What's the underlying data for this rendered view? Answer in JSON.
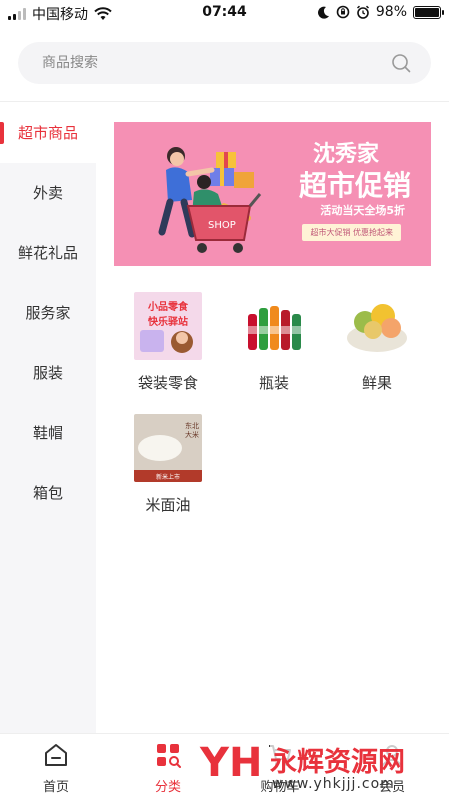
{
  "status_bar": {
    "carrier": "中国移动",
    "time": "07:44",
    "battery": "98%",
    "battery_level": 0.98
  },
  "search": {
    "placeholder": "商品搜索",
    "icon": "search-icon"
  },
  "sidebar": {
    "items": [
      {
        "label": "超市商品",
        "active": true
      },
      {
        "label": "外卖",
        "active": false
      },
      {
        "label": "鲜花礼品",
        "active": false
      },
      {
        "label": "服务家",
        "active": false
      },
      {
        "label": "服装",
        "active": false
      },
      {
        "label": "鞋帽",
        "active": false
      },
      {
        "label": "箱包",
        "active": false
      }
    ]
  },
  "banner": {
    "line1": "沈秀家",
    "line2": "超市促销",
    "line3": "活动当天全场5折",
    "pill": "超市大促销 优惠抢起来",
    "cart_text": "SHOP",
    "color": "#f590b4"
  },
  "categories": [
    {
      "label": "袋装零食",
      "thumb_text1": "小品零食",
      "thumb_text2": "快乐驿站"
    },
    {
      "label": "瓶装"
    },
    {
      "label": "鲜果"
    },
    {
      "label": "米面油",
      "thumb_text1": "东北大米",
      "thumb_text2": "新米上市"
    }
  ],
  "tabbar": {
    "items": [
      {
        "label": "首页",
        "icon": "home-icon",
        "active": false
      },
      {
        "label": "分类",
        "icon": "category-icon",
        "active": true
      },
      {
        "label": "购物车",
        "icon": "cart-icon",
        "active": false
      },
      {
        "label": "会员",
        "icon": "member-icon",
        "active": false
      }
    ]
  },
  "watermark": {
    "logo": "YH",
    "title": "永辉资源网",
    "url": "www.yhkjjj.com"
  },
  "colors": {
    "accent": "#e8323c",
    "sidebar_bg": "#f6f6f8",
    "search_bg": "#f4f4f6"
  }
}
